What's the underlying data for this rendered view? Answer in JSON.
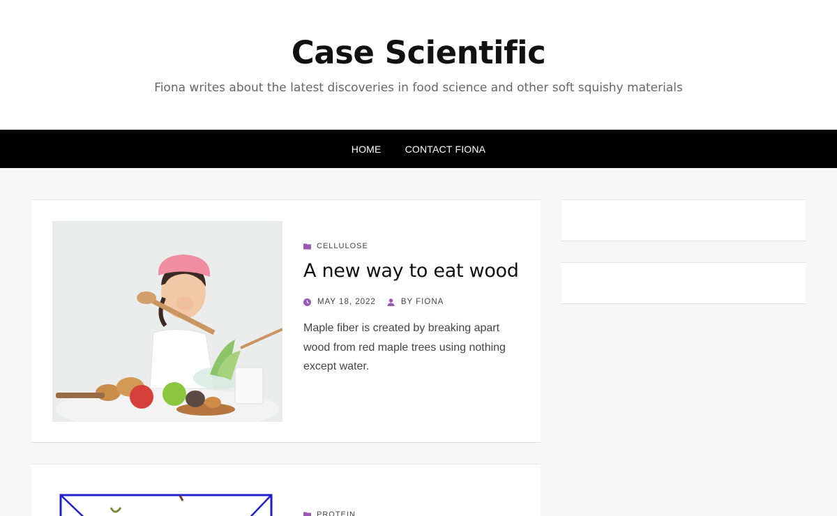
{
  "site": {
    "title": "Case Scientific",
    "description": "Fiona writes about the latest discoveries in food science and other soft squishy materials"
  },
  "nav": {
    "items": [
      "HOME",
      "CONTACT FIONA"
    ]
  },
  "posts": [
    {
      "category": "CELLULOSE",
      "title": "A new way to eat wood",
      "date": "MAY 18, 2022",
      "author": "BY FIONA",
      "excerpt": "Maple fiber is created by breaking apart wood from red maple trees using nothing except water."
    },
    {
      "category": "PROTEIN"
    }
  ],
  "colors": {
    "accent": "#9b59b6",
    "nav_bg": "#000000",
    "page_bg": "#f7f7f7"
  },
  "icons": {
    "category": "folder-icon",
    "date": "clock-icon",
    "author": "user-icon"
  }
}
